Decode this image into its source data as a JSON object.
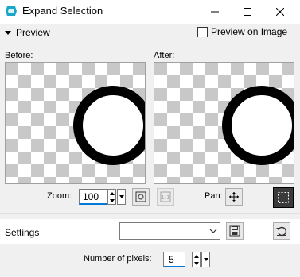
{
  "window": {
    "title": "Expand Selection",
    "controls": [
      "minimize-icon",
      "maximize-icon",
      "close-icon"
    ]
  },
  "preview": {
    "toggle_label": "Preview",
    "preview_on_image_label": "Preview on Image",
    "preview_on_image_checked": false,
    "before_label": "Before:",
    "after_label": "After:"
  },
  "zoom": {
    "label": "Zoom:",
    "value": "100",
    "fit_icon": "zoom-fit-icon",
    "actual_size_icon": "zoom-1to1-icon"
  },
  "pan": {
    "label": "Pan:",
    "icon": "pan-move-icon",
    "selection_icon": "selection-marquee-icon"
  },
  "settings": {
    "label": "Settings",
    "preset_value": "",
    "save_icon": "save-preset-icon",
    "reset_icon": "reset-defaults-icon"
  },
  "expand": {
    "pixels_label": "Number of pixels:",
    "pixels_value": "5"
  },
  "colors": {
    "accent": "#0078d7",
    "app_icon": "#1aa6c8",
    "checker_light": "#ffffff",
    "checker_dark": "#c8c8c8"
  }
}
